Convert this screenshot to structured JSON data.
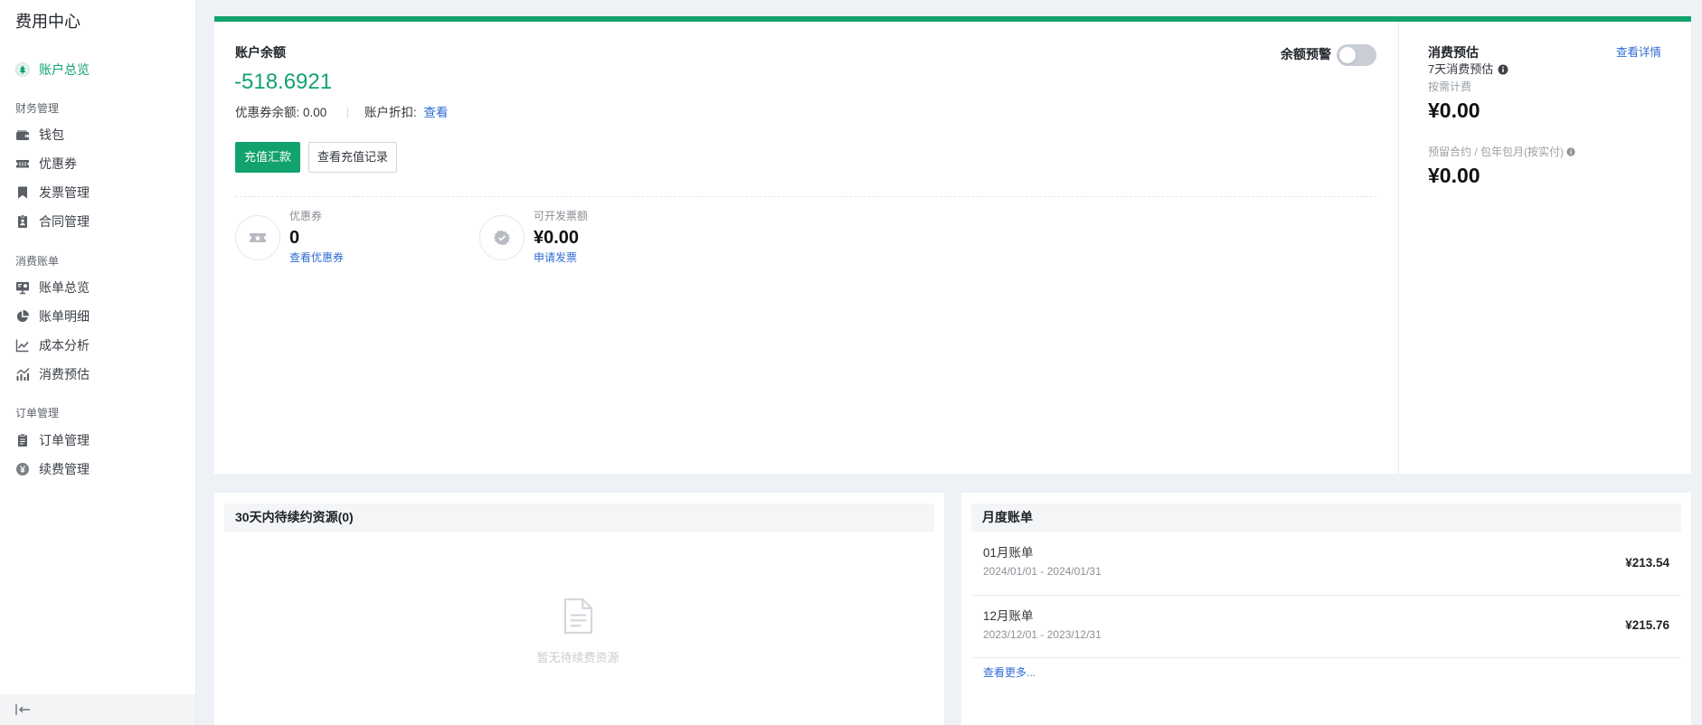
{
  "colors": {
    "accent": "#12a26e",
    "link": "#2f6bd6"
  },
  "sidebar": {
    "title": "费用中心",
    "overview": {
      "label": "账户总览",
      "icon": "tree-icon"
    },
    "sections": [
      {
        "heading": "财务管理",
        "items": [
          {
            "label": "钱包",
            "icon": "wallet-icon"
          },
          {
            "label": "优惠券",
            "icon": "coupon-icon"
          },
          {
            "label": "发票管理",
            "icon": "bookmark-icon"
          },
          {
            "label": "合同管理",
            "icon": "contract-icon"
          }
        ]
      },
      {
        "heading": "消费账单",
        "items": [
          {
            "label": "账单总览",
            "icon": "presentation-icon"
          },
          {
            "label": "账单明细",
            "icon": "pie-chart-icon"
          },
          {
            "label": "成本分析",
            "icon": "line-chart-icon"
          },
          {
            "label": "消费预估",
            "icon": "bar-chart-icon"
          }
        ]
      },
      {
        "heading": "订单管理",
        "items": [
          {
            "label": "订单管理",
            "icon": "clipboard-icon"
          },
          {
            "label": "续费管理",
            "icon": "yen-circle-icon"
          }
        ]
      }
    ],
    "collapse_icon": "collapse-icon"
  },
  "account": {
    "title": "账户余额",
    "balance": "-518.6921",
    "coupon_balance": "优惠券余额: 0.00",
    "discount_label": "账户折扣:",
    "discount_link": "查看",
    "alert": {
      "label": "余额预警",
      "enabled": false
    },
    "buttons": {
      "recharge": "充值汇款",
      "recharge_history": "查看充值记录"
    },
    "stats": [
      {
        "label": "优惠券",
        "value": "0",
        "link": "查看优惠券",
        "icon": "ticket-icon"
      },
      {
        "label": "可开发票额",
        "value": "¥0.00",
        "link": "申请发票",
        "icon": "verified-badge-icon"
      }
    ]
  },
  "estimate": {
    "title": "消费预估",
    "detail_link": "查看详情",
    "subtitle": "7天消费预估",
    "on_demand_label": "按需计费",
    "on_demand_value": "¥0.00",
    "reserved_label": "预留合约 / 包年包月(按实付)",
    "reserved_value": "¥0.00"
  },
  "renewal": {
    "title": "30天内待续约资源(0)",
    "empty_text": "暂无待续费资源",
    "empty_icon": "document-icon"
  },
  "monthly_bills": {
    "title": "月度账单",
    "rows": [
      {
        "name": "01月账单",
        "period": "2024/01/01 - 2024/01/31",
        "amount": "¥213.54"
      },
      {
        "name": "12月账单",
        "period": "2023/12/01 - 2023/12/31",
        "amount": "¥215.76"
      }
    ],
    "more_link": "查看更多..."
  }
}
